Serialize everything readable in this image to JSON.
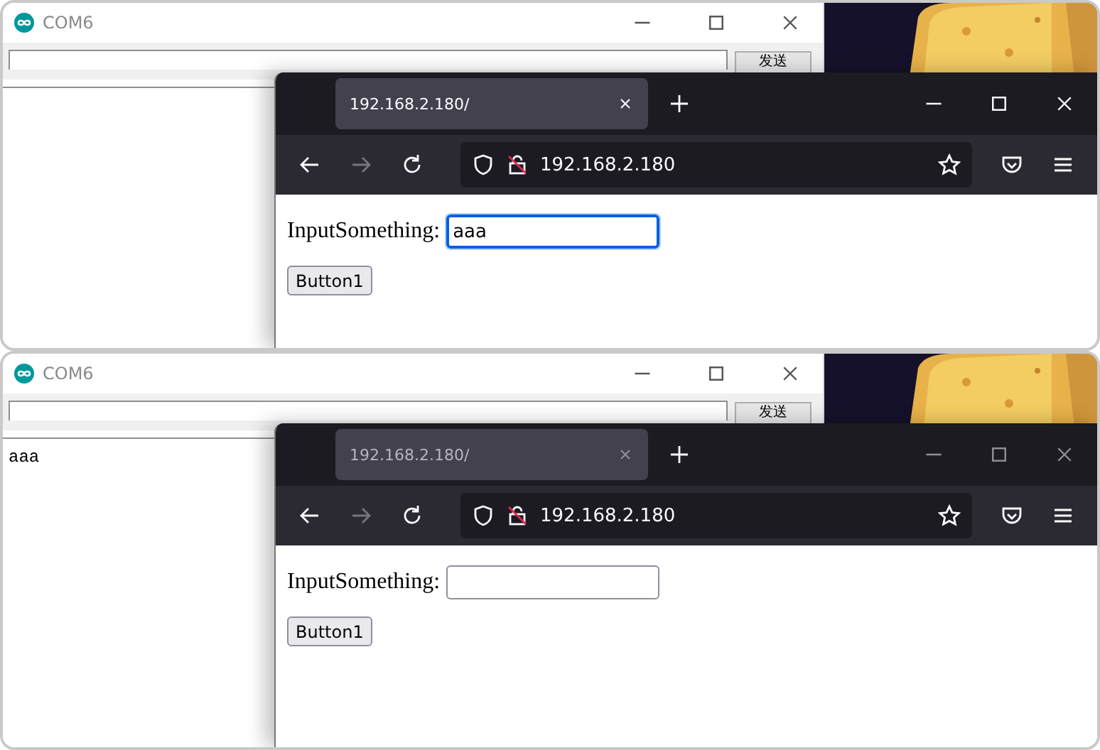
{
  "panels": [
    {
      "serial": {
        "title": "COM6",
        "send_button": "发送"
      },
      "browser": {
        "focused": true,
        "tab_title": "192.168.2.180/",
        "url": "192.168.2.180",
        "label": "InputSomething:",
        "input_value": "aaa",
        "input_focused": true,
        "button": "Button1"
      }
    },
    {
      "serial": {
        "title": "COM6",
        "send_button": "发送",
        "output": [
          "aaa"
        ]
      },
      "browser": {
        "focused": false,
        "tab_title": "192.168.2.180/",
        "url": "192.168.2.180",
        "label": "InputSomething:",
        "input_focused": false,
        "button": "Button1"
      }
    }
  ]
}
